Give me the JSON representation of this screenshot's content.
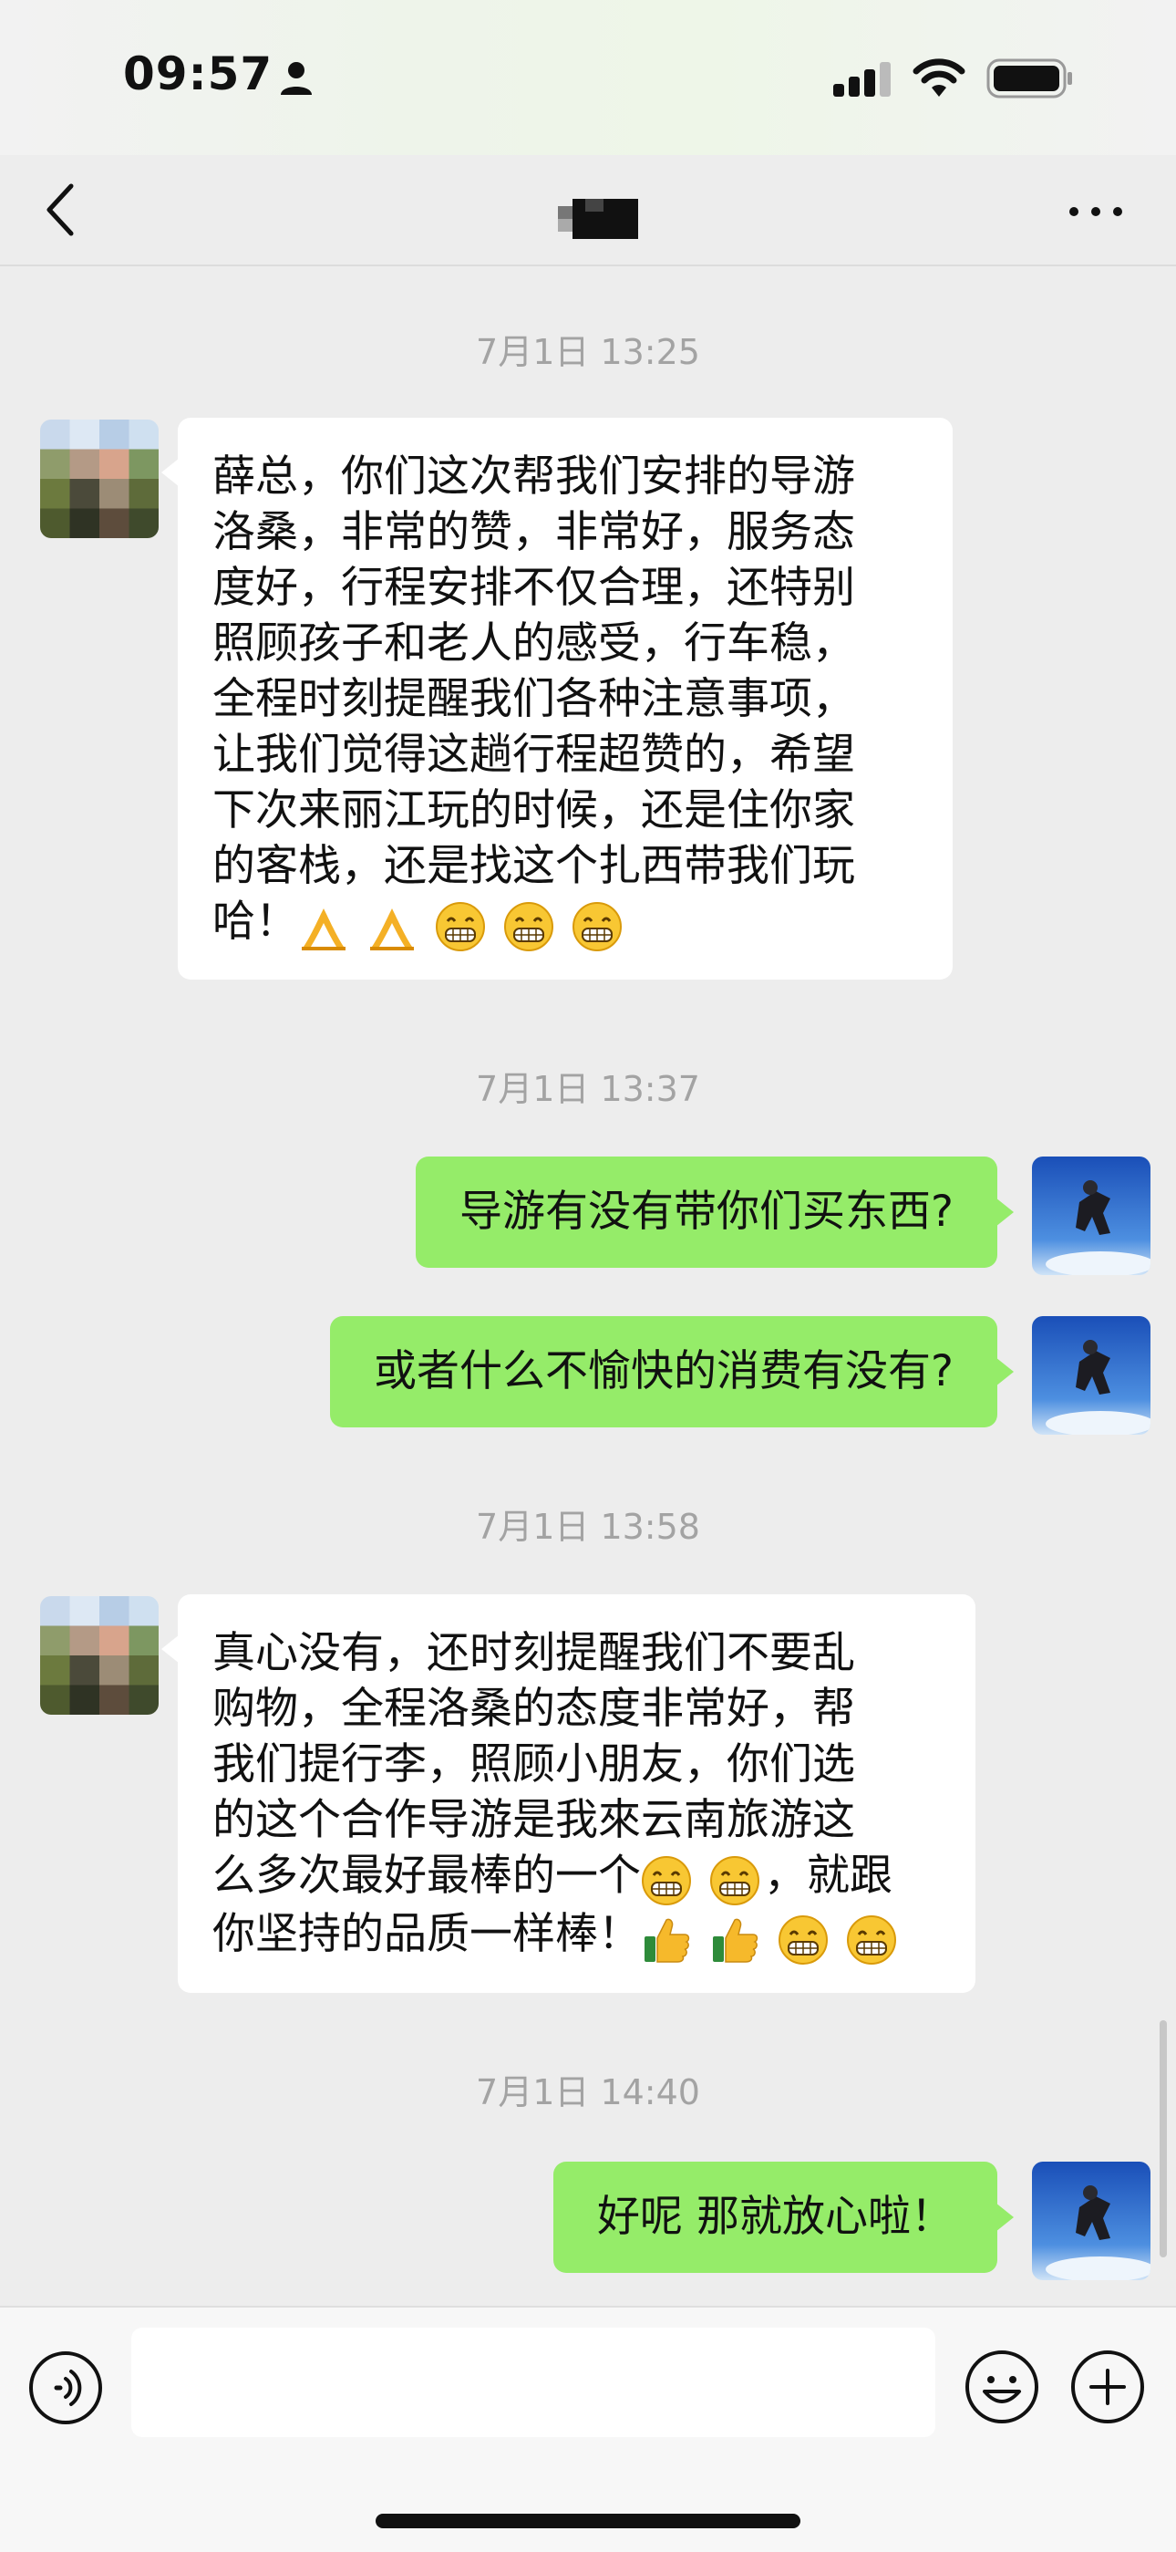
{
  "status_bar": {
    "time": "09:57"
  },
  "nav": {
    "chat_title": ""
  },
  "messages": [
    {
      "type": "timestamp",
      "text": "7月1日 13:25"
    },
    {
      "type": "incoming",
      "lines": [
        "薛总，你们这次帮我们安排的导游",
        "洛桑，非常的赞，非常好，服务态",
        "度好，行程安排不仅合理，还特别",
        "照顾孩子和老人的感受，行车稳，",
        "全程时刻提醒我们各种注意事项，",
        "让我们觉得这趟行程超赞的，希望",
        "下次来丽江玩的时候，还是住你家",
        "的客栈，还是找这个扎西带我们玩",
        "哈！"
      ],
      "emojis": [
        "pray-emoji",
        "pray-emoji",
        "grin-emoji",
        "grin-emoji",
        "grin-emoji"
      ]
    },
    {
      "type": "timestamp",
      "text": "7月1日 13:37"
    },
    {
      "type": "outgoing",
      "text": "导游有没有带你们买东西?"
    },
    {
      "type": "outgoing",
      "text": "或者什么不愉快的消费有没有?"
    },
    {
      "type": "timestamp",
      "text": "7月1日 13:58"
    },
    {
      "type": "incoming",
      "lines": [
        "真心没有，还时刻提醒我们不要乱",
        "购物，全程洛桑的态度非常好，帮",
        "我们提行李，照顾小朋友，你们选",
        "的这个合作导游是我來云南旅游这",
        "么多次最好最棒的一个",
        "你坚持的品质一样棒！"
      ],
      "inline_suffix": "，就跟",
      "emojis_line5": [
        "grin-emoji",
        "grin-emoji"
      ],
      "emojis_line6": [
        "thumbs-up-emoji",
        "thumbs-up-emoji",
        "grin-emoji",
        "grin-emoji"
      ]
    },
    {
      "type": "timestamp",
      "text": "7月1日 14:40"
    },
    {
      "type": "outgoing",
      "text": "好呢 那就放心啦！"
    }
  ],
  "input": {
    "placeholder": ""
  },
  "colors": {
    "outgoing_bubble": "#95ec69",
    "incoming_bubble": "#ffffff",
    "background": "#ededed",
    "timestamp": "#a3a3a3"
  }
}
